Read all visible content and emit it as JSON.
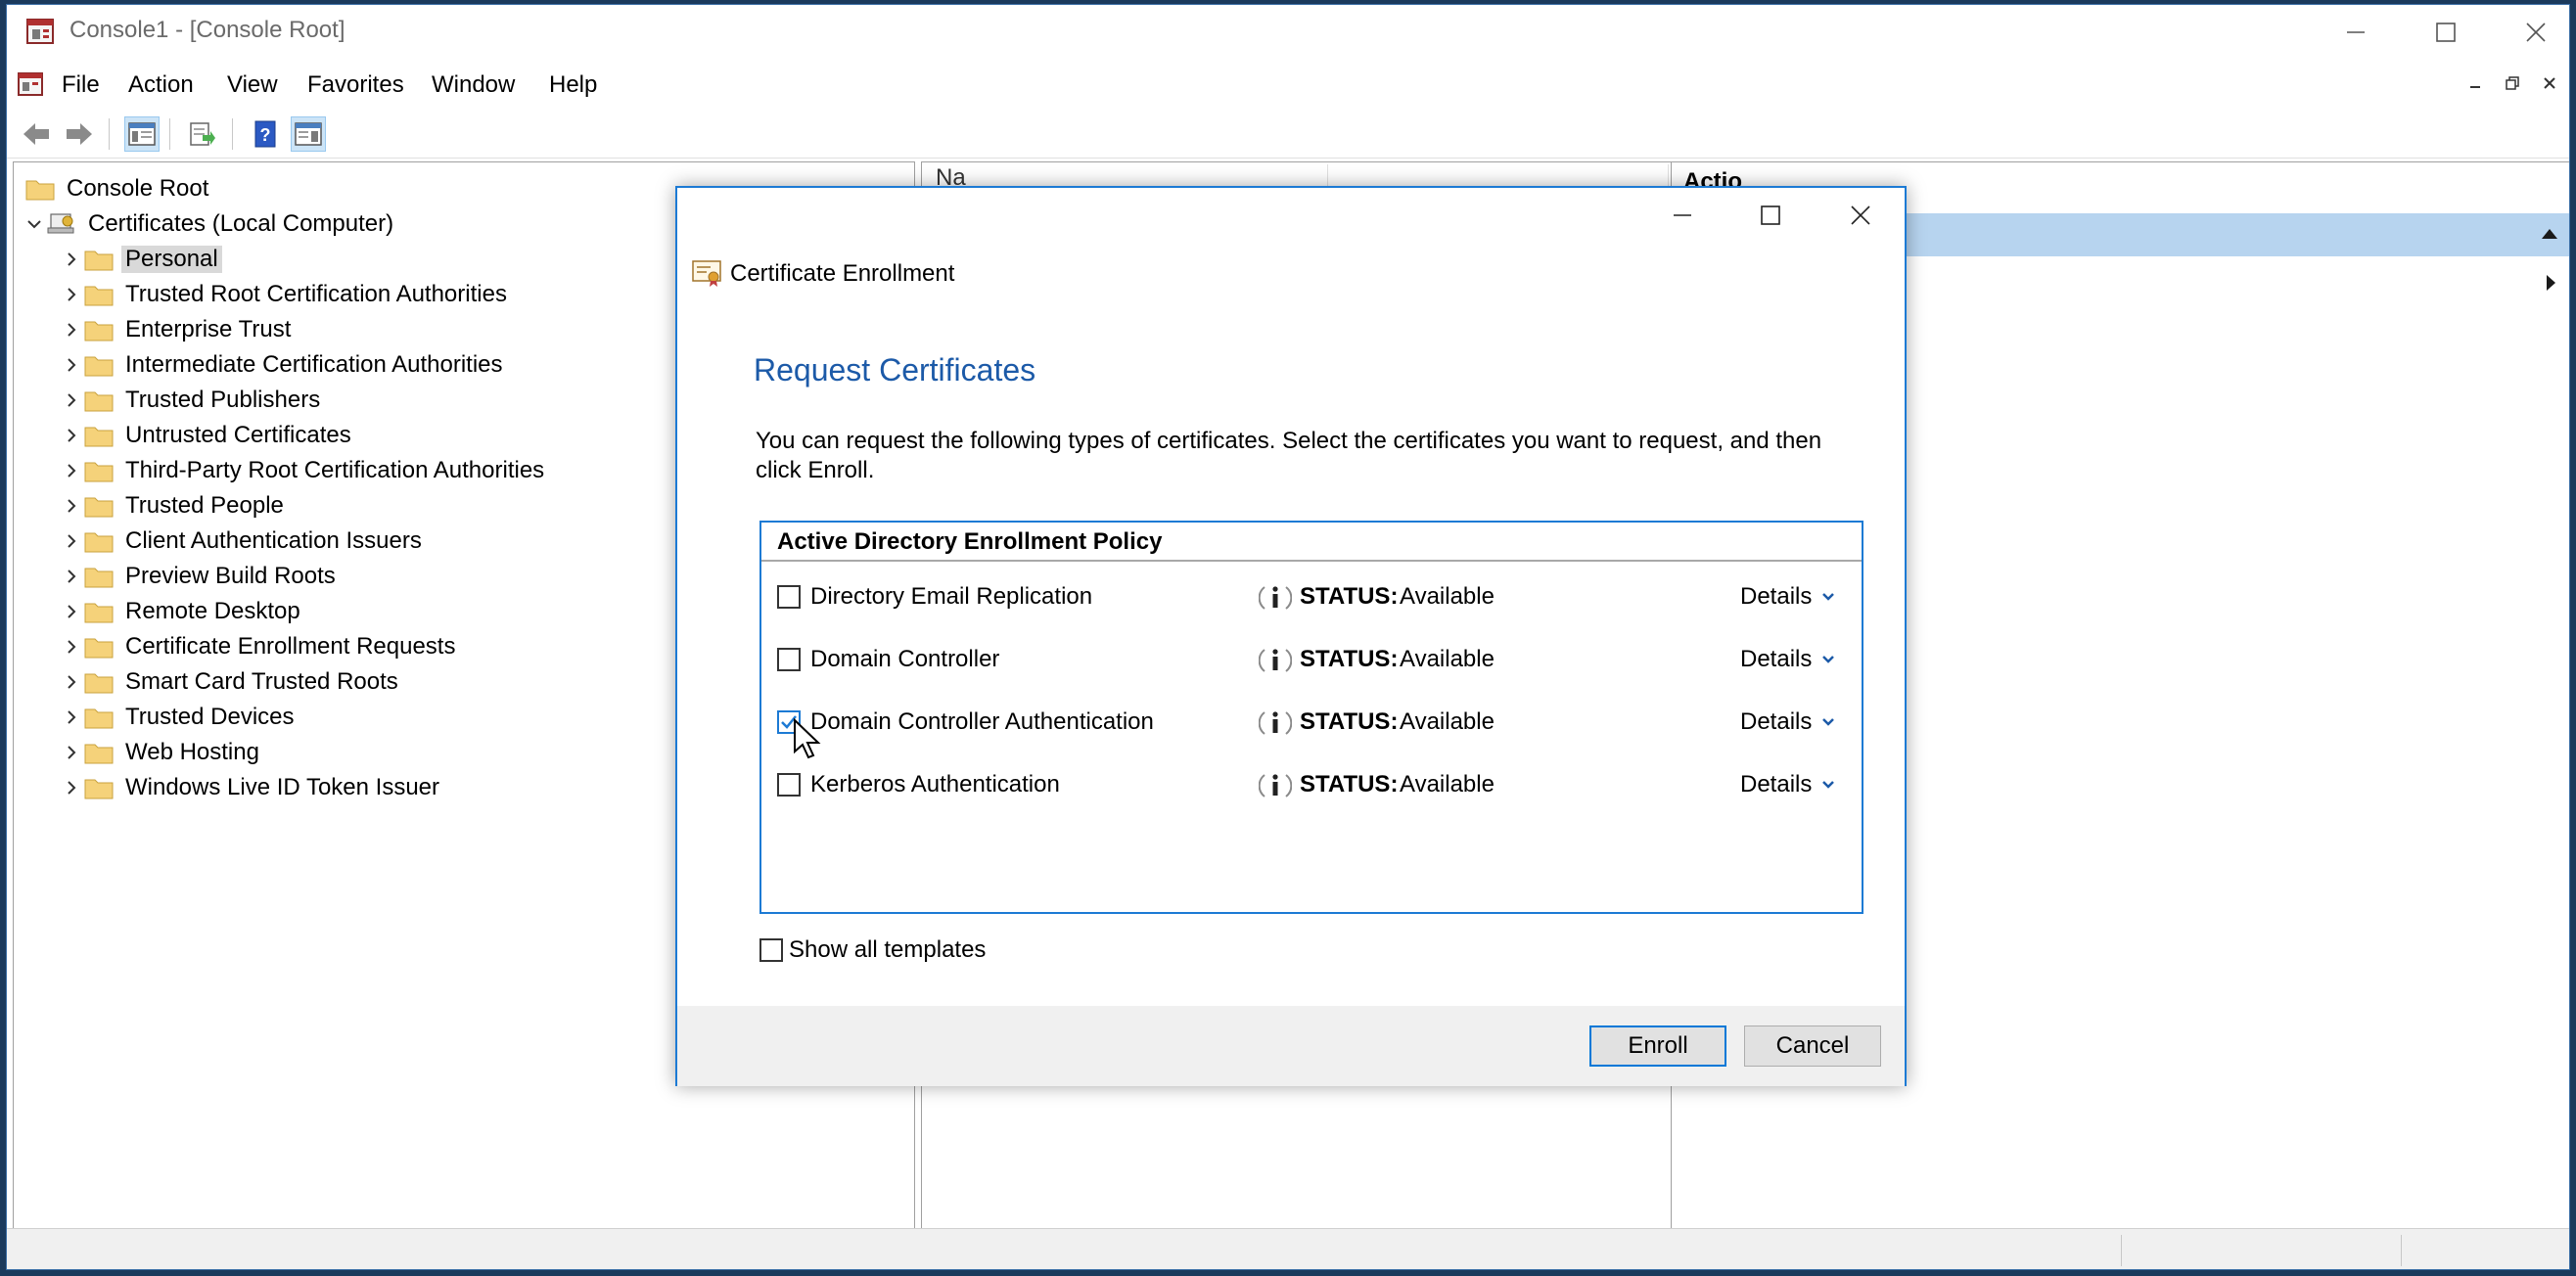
{
  "window": {
    "title": "Console1 - [Console Root]"
  },
  "menu": {
    "items": [
      "File",
      "Action",
      "View",
      "Favorites",
      "Window",
      "Help"
    ]
  },
  "toolbar": {
    "buttons": [
      "back-arrow-icon",
      "forward-arrow-icon",
      "show-hide-tree-icon",
      "export-list-icon",
      "help-icon",
      "show-hide-action-pane-icon"
    ]
  },
  "tree": {
    "root": "Console Root",
    "computer": "Certificates (Local Computer)",
    "stores": [
      "Personal",
      "Trusted Root Certification Authorities",
      "Enterprise Trust",
      "Intermediate Certification Authorities",
      "Trusted Publishers",
      "Untrusted Certificates",
      "Third-Party Root Certification Authorities",
      "Trusted People",
      "Client Authentication Issuers",
      "Preview Build Roots",
      "Remote Desktop",
      "Certificate Enrollment Requests",
      "Smart Card Trusted Roots",
      "Trusted Devices",
      "Web Hosting",
      "Windows Live ID Token Issuer"
    ],
    "selected": "Personal"
  },
  "middle": {
    "col1": "Na",
    "col2": ""
  },
  "actions": {
    "header": "Actio"
  },
  "dialog": {
    "title": "Certificate Enrollment",
    "heading": "Request Certificates",
    "description": "You can request the following types of certificates. Select the certificates you want to request, and then click Enroll.",
    "policy_title": "Active Directory Enrollment Policy",
    "status_label": "STATUS:",
    "details_label": "Details",
    "certificates": [
      {
        "name": "Directory Email Replication",
        "status": "Available",
        "checked": false
      },
      {
        "name": "Domain Controller",
        "status": "Available",
        "checked": false
      },
      {
        "name": "Domain Controller Authentication",
        "status": "Available",
        "checked": true
      },
      {
        "name": "Kerberos Authentication",
        "status": "Available",
        "checked": false
      }
    ],
    "show_all_label": "Show all templates",
    "enroll_label": "Enroll",
    "cancel_label": "Cancel"
  },
  "colors": {
    "accent": "#1c7ad4",
    "heading": "#1c5aa8",
    "action_bar": "#b7d4ef"
  }
}
